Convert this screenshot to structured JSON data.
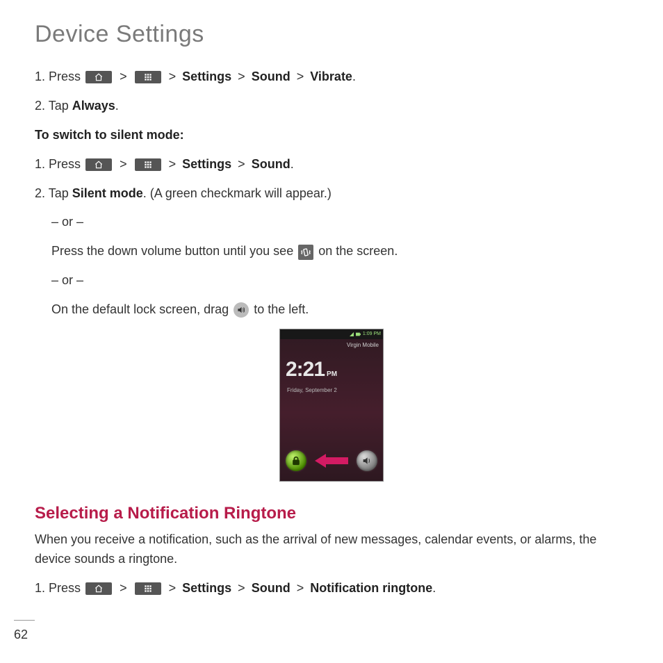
{
  "page_title": "Device Settings",
  "step1": {
    "prefix": "1. Press",
    "sep": ">",
    "settings": "Settings",
    "sound": "Sound",
    "vibrate": "Vibrate",
    "dot": "."
  },
  "step2": {
    "prefix": "2. Tap",
    "always": "Always",
    "dot": "."
  },
  "switch_heading": "To switch to silent mode:",
  "step3": {
    "prefix": "1. Press",
    "sep": ">",
    "settings": "Settings",
    "sound": "Sound",
    "dot": "."
  },
  "step4": {
    "prefix": "2. Tap",
    "silent": "Silent mode",
    "rest": ". (A green checkmark will appear.)"
  },
  "or": "– or –",
  "vol_a": "Press the down volume button until you see",
  "vol_b": "on the screen.",
  "lock_a": "On the default lock screen, drag",
  "lock_b": "to the left.",
  "phone": {
    "status_time": "1:09 PM",
    "carrier": "Virgin Mobile",
    "hhmm": "2:21",
    "ampm": "PM",
    "date": "Friday, September 2"
  },
  "section2_title": "Selecting a Notification Ringtone",
  "section2_body": "When you receive a notification, such as the arrival of new messages, calendar events, or alarms, the device sounds a ringtone.",
  "step5": {
    "prefix": "1. Press",
    "sep": ">",
    "settings": "Settings",
    "sound": "Sound",
    "notif": "Notification ringtone",
    "dot": "."
  },
  "page_number": "62"
}
